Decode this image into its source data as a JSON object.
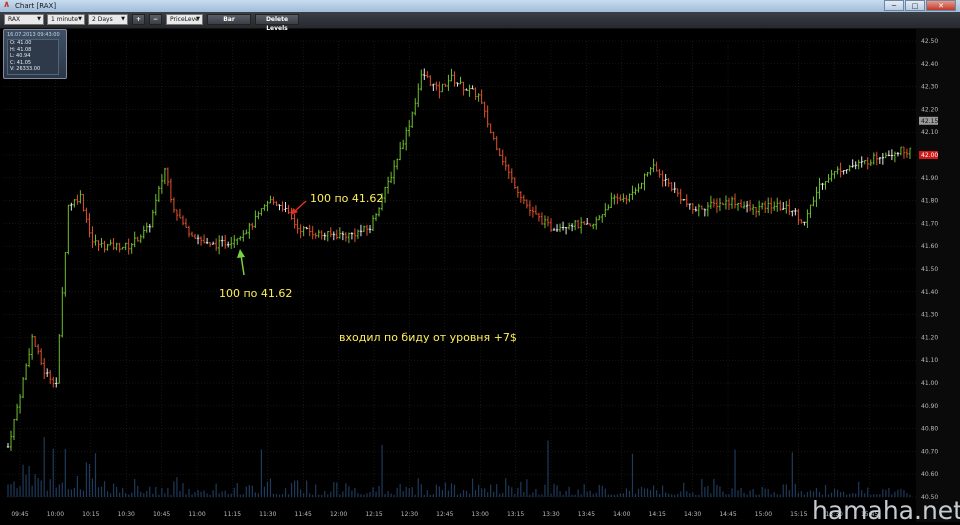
{
  "window": {
    "title": "Chart [RAX]",
    "buttons": {
      "minimize": "─",
      "maximize": "□",
      "close": "✕"
    }
  },
  "toolbar": {
    "symbol": "RAX",
    "interval": "1 minute",
    "range": "2 Days",
    "zoom_in": "+",
    "zoom_out": "−",
    "mode": "PriceLeve",
    "chart_type": "Bar",
    "delete_levels": "Delete Levels"
  },
  "info_box": {
    "timestamp": "16.07.2013 09:43:00",
    "open": "O: 41.00",
    "high": "H: 41.08",
    "low": "L: 40.94",
    "close": "C: 41.05",
    "volume": "V: 26333.00"
  },
  "annotations": {
    "sell_label": "100 по 41.62",
    "buy_label": "100 по 41.62",
    "comment": "входил по биду от уровня +7$"
  },
  "watermark": "hamaha.net",
  "colors": {
    "up": "#6fbf2e",
    "down": "#e0522a",
    "neutral": "#e8e8e8",
    "volume": "#1f3a5a",
    "grid": "#2a2a2a",
    "annotation_text": "#ffef5a",
    "arrow_sell": "#e03020",
    "arrow_buy": "#7ad040",
    "price_tag_last": "#d01818",
    "price_tag_prev": "#9a9a9a"
  },
  "chart_data": {
    "type": "bar",
    "symbol": "RAX",
    "y_ticks": [
      "42.50",
      "42.40",
      "42.30",
      "42.20",
      "42.10",
      "42.00",
      "41.90",
      "41.80",
      "41.70",
      "41.60",
      "41.50",
      "41.40",
      "41.30",
      "41.20",
      "41.10",
      "41.00",
      "40.90",
      "40.80",
      "40.70",
      "40.60",
      "40.50"
    ],
    "ylim": [
      40.5,
      42.5
    ],
    "x_ticks": [
      "09:45",
      "10:00",
      "10:15",
      "10:30",
      "10:45",
      "11:00",
      "11:15",
      "11:30",
      "11:45",
      "12:00",
      "12:15",
      "12:30",
      "12:45",
      "13:00",
      "13:15",
      "13:30",
      "13:45",
      "14:00",
      "14:15",
      "14:30",
      "14:45",
      "15:00",
      "15:15",
      "15:30",
      "15:45"
    ],
    "price_tags": {
      "prev": "42.15",
      "last": "42.00"
    },
    "price_path": [
      [
        0,
        40.72
      ],
      [
        3,
        40.95
      ],
      [
        6,
        41.2
      ],
      [
        9,
        41.05
      ],
      [
        12,
        41.0
      ],
      [
        15,
        41.78
      ],
      [
        18,
        41.82
      ],
      [
        21,
        41.62
      ],
      [
        24,
        41.6
      ],
      [
        30,
        41.6
      ],
      [
        35,
        41.68
      ],
      [
        39,
        41.94
      ],
      [
        41,
        41.78
      ],
      [
        44,
        41.68
      ],
      [
        50,
        41.6
      ],
      [
        55,
        41.62
      ],
      [
        60,
        41.68
      ],
      [
        65,
        41.8
      ],
      [
        68,
        41.78
      ],
      [
        72,
        41.68
      ],
      [
        78,
        41.65
      ],
      [
        85,
        41.65
      ],
      [
        90,
        41.68
      ],
      [
        95,
        41.9
      ],
      [
        100,
        42.15
      ],
      [
        103,
        42.36
      ],
      [
        107,
        42.28
      ],
      [
        110,
        42.34
      ],
      [
        113,
        42.3
      ],
      [
        117,
        42.26
      ],
      [
        120,
        42.1
      ],
      [
        125,
        41.9
      ],
      [
        130,
        41.75
      ],
      [
        135,
        41.68
      ],
      [
        140,
        41.7
      ],
      [
        145,
        41.68
      ],
      [
        150,
        41.8
      ],
      [
        155,
        41.82
      ],
      [
        160,
        41.95
      ],
      [
        165,
        41.86
      ],
      [
        170,
        41.76
      ],
      [
        175,
        41.78
      ],
      [
        180,
        41.8
      ],
      [
        185,
        41.76
      ],
      [
        190,
        41.78
      ],
      [
        195,
        41.76
      ],
      [
        198,
        41.7
      ],
      [
        202,
        41.88
      ],
      [
        207,
        41.94
      ],
      [
        212,
        41.96
      ],
      [
        217,
        42.0
      ],
      [
        222,
        42.02
      ],
      [
        225,
        42.02
      ]
    ]
  }
}
